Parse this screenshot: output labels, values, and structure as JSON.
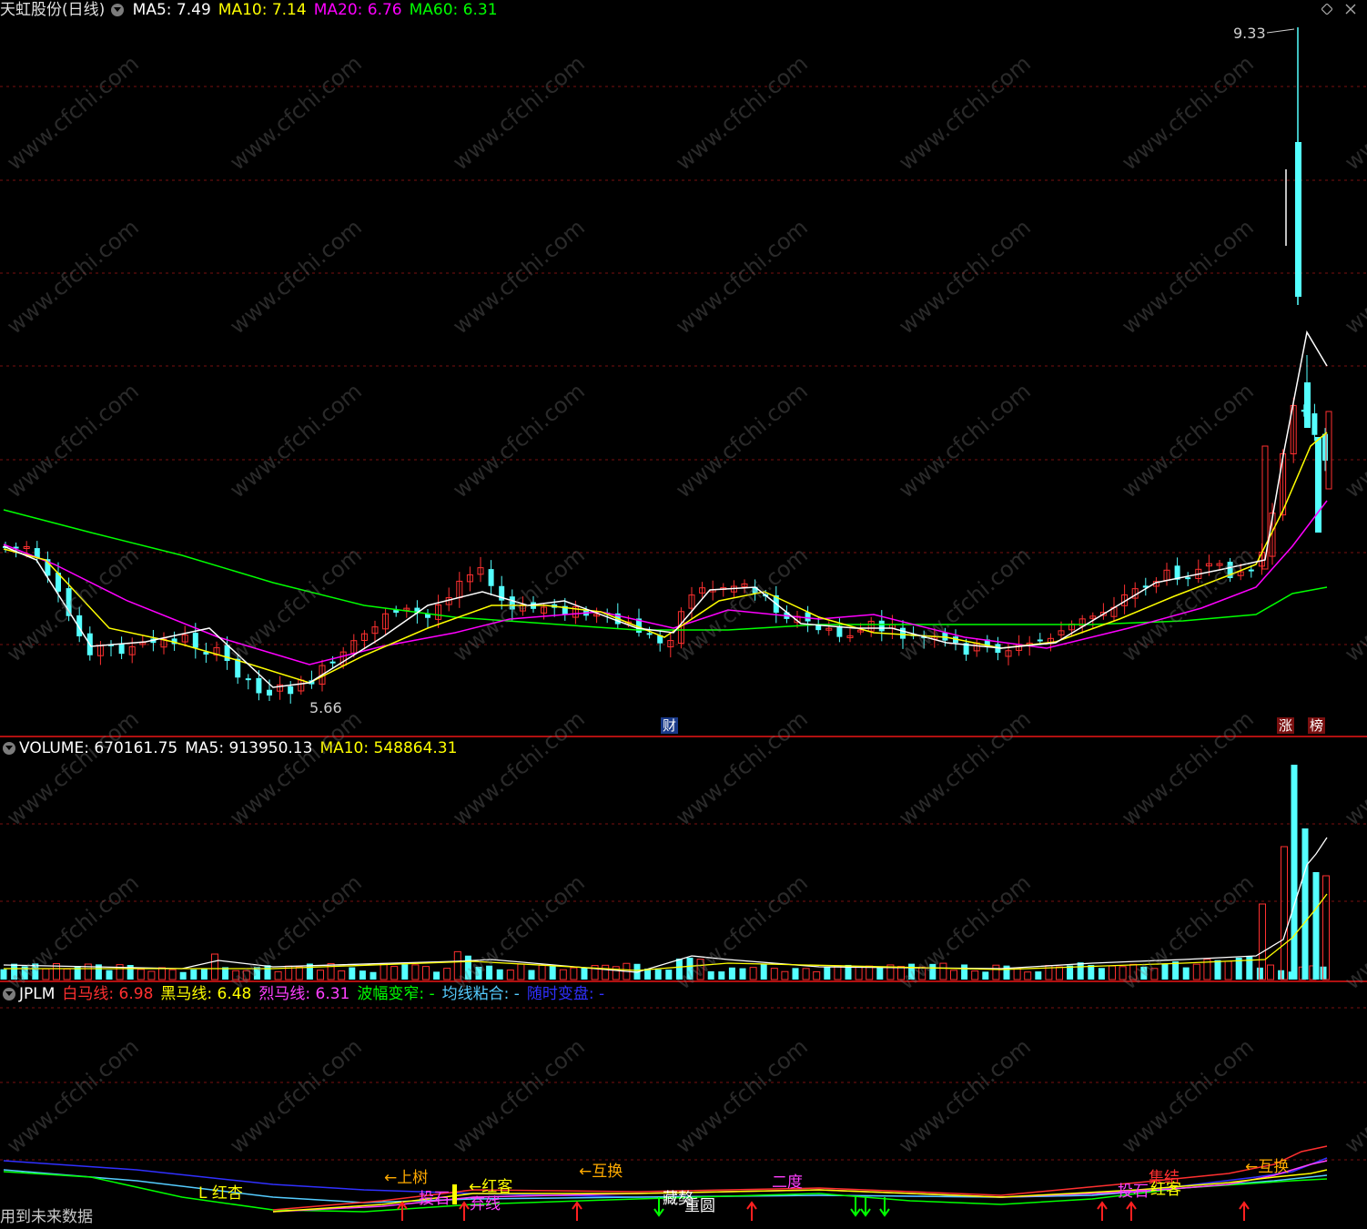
{
  "main": {
    "stock_name": "天虹股份(日线)",
    "ma_labels": [
      {
        "text": "MA5: 7.49",
        "color": "#ffffff"
      },
      {
        "text": "MA10: 7.14",
        "color": "#ffff00"
      },
      {
        "text": "MA20: 6.76",
        "color": "#ff00ff"
      },
      {
        "text": "MA60: 6.31",
        "color": "#00ff00"
      }
    ],
    "high_label": "9.33",
    "low_label": "5.66",
    "markers": {
      "cai": "财",
      "zhang": "涨",
      "bang": "榜"
    }
  },
  "volume": {
    "labels": [
      {
        "text": "VOLUME: 670161.75",
        "color": "#ffffff"
      },
      {
        "text": "MA5: 913950.13",
        "color": "#ffffff"
      },
      {
        "text": "MA10: 548864.31",
        "color": "#ffff00"
      }
    ]
  },
  "jplm": {
    "labels": [
      {
        "text": "JPLM",
        "color": "#ffffff"
      },
      {
        "text": "白马线: 6.98",
        "color": "#ff3030"
      },
      {
        "text": "黑马线: 6.48",
        "color": "#ffff00"
      },
      {
        "text": "烈马线: 6.31",
        "color": "#ff40ff"
      },
      {
        "text": "波幅变窄: -",
        "color": "#00ff00"
      },
      {
        "text": "均线粘合: -",
        "color": "#55ccff"
      },
      {
        "text": "随时变盘: -",
        "color": "#3030ff"
      }
    ],
    "annotations": [
      {
        "text": "L 红杏",
        "color": "#ffff00"
      },
      {
        "text": "←上树",
        "color": "#ffaa00"
      },
      {
        "text": "投石",
        "color": "#ff40ff"
      },
      {
        "text": "←红客",
        "color": "#ffff00"
      },
      {
        "text": "弃线",
        "color": "#ff40ff"
      },
      {
        "text": "←互换",
        "color": "#ffaa00"
      },
      {
        "text": "藏獒",
        "color": "#ffffff"
      },
      {
        "text": "重圆",
        "color": "#ffffff"
      },
      {
        "text": "二度",
        "color": "#ff40ff"
      },
      {
        "text": "投石",
        "color": "#ff40ff"
      },
      {
        "text": "集结",
        "color": "#ff3030"
      },
      {
        "text": "红客",
        "color": "#ffff00"
      },
      {
        "text": "←互换",
        "color": "#ffaa00"
      }
    ],
    "footer": "用到未来数据"
  },
  "watermark": "www.cfchi.com",
  "colors": {
    "up": "#ff3030",
    "down": "#54ffff",
    "ma5": "#ffffff",
    "ma10": "#ffff00",
    "ma20": "#ff00ff",
    "ma60": "#00ff00",
    "grid": "#7a1010"
  }
}
